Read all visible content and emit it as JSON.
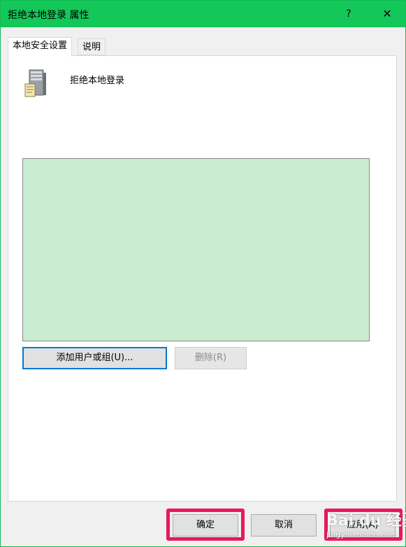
{
  "window": {
    "title": "拒绝本地登录 属性",
    "help_label": "?",
    "close_label": "✕",
    "accent_color": "#13c859"
  },
  "tabs": [
    {
      "label": "本地安全设置",
      "active": true
    },
    {
      "label": "说明",
      "active": false
    }
  ],
  "panel": {
    "policy_icon": "server-icon",
    "policy_name": "拒绝本地登录",
    "users": []
  },
  "buttons": {
    "add_label": "添加用户或组(U)...",
    "remove_label": "删除(R)",
    "ok_label": "确定",
    "cancel_label": "取消",
    "apply_label": "应用(A)"
  },
  "highlight_color": "#e8195b",
  "watermark": {
    "top": "Bai du 经验",
    "bottom": "jingyan.baidu.com"
  }
}
